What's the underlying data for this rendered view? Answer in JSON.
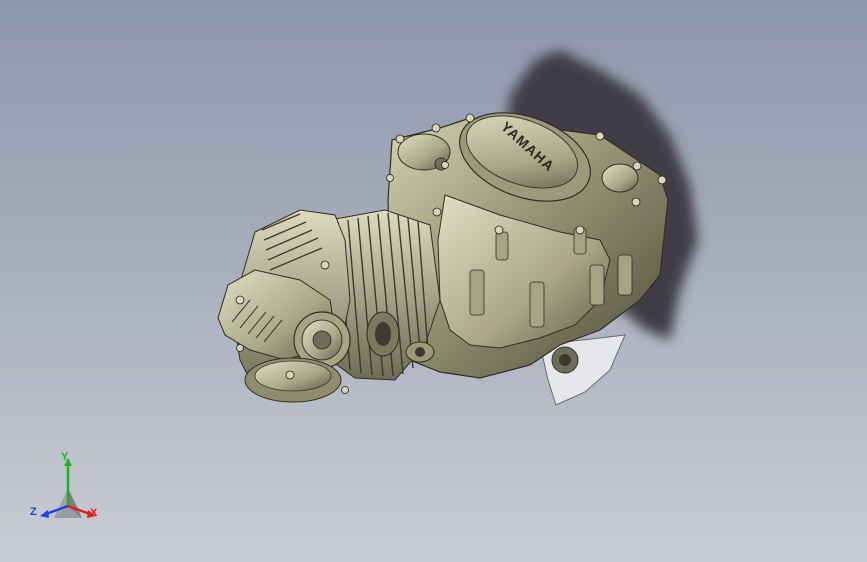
{
  "model": {
    "brand_label": "YAMAHA",
    "colors": {
      "body": "#8e8c6c",
      "body_light": "#c7c6a4",
      "body_dark": "#4a4936",
      "shadow": "#3f3d47",
      "sprocket_guard": "#e7e8ea"
    }
  },
  "triad": {
    "x_label": "X",
    "y_label": "Y",
    "z_label": "Z",
    "colors": {
      "x": "#e02020",
      "y": "#20b020",
      "z": "#2040e0"
    }
  }
}
